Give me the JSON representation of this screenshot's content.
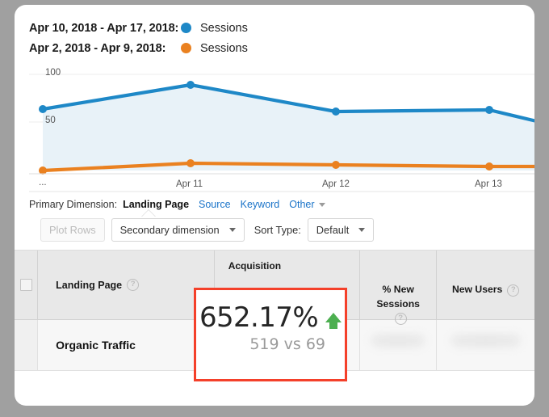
{
  "legend": [
    {
      "range": "Apr 10, 2018 - Apr 17, 2018:",
      "metric": "Sessions",
      "color": "#1e88c7"
    },
    {
      "range": "Apr 2, 2018 - Apr 9, 2018:",
      "metric": "Sessions",
      "color": "#ea8120"
    }
  ],
  "chart_data": {
    "type": "line",
    "title": "",
    "xlabel": "",
    "ylabel": "",
    "ylim": [
      0,
      110
    ],
    "yticks": [
      50,
      100
    ],
    "ytick_labels": [
      "50",
      "100"
    ],
    "grid": true,
    "legend_position": "top",
    "x": [
      "...",
      "Apr 11",
      "Apr 12",
      "Apr 13",
      ""
    ],
    "xtick_labels": [
      "...",
      "Apr 11",
      "Apr 12",
      "Apr 13"
    ],
    "series": [
      {
        "name": "Sessions",
        "label": "Apr 10, 2018 - Apr 17, 2018",
        "color": "#1e88c7",
        "fill": "#e7f1f8",
        "values": [
          72,
          92,
          70,
          71,
          61
        ]
      },
      {
        "name": "Sessions",
        "label": "Apr 2, 2018 - Apr 9, 2018",
        "color": "#ea8120",
        "values": [
          4,
          12,
          10,
          9,
          9
        ]
      }
    ]
  },
  "primary_dimension": {
    "label": "Primary Dimension:",
    "active": "Landing Page",
    "links": [
      "Source",
      "Keyword"
    ],
    "other": "Other"
  },
  "controls": {
    "plot_rows": "Plot Rows",
    "secondary_dimension": "Secondary dimension",
    "sort_type_label": "Sort Type:",
    "sort_type_value": "Default"
  },
  "table": {
    "group_header": "Acquisition",
    "columns": {
      "landing_page": "Landing Page",
      "new_sessions": "% New Sessions",
      "new_users": "New Users"
    },
    "help_glyph": "?",
    "rows": [
      {
        "landing_page": "Organic Traffic"
      }
    ]
  },
  "callout": {
    "percent": "652.17%",
    "comparison": "519 vs 69",
    "direction": "up",
    "border_color": "#f4402a",
    "arrow_color": "#4caf50"
  }
}
